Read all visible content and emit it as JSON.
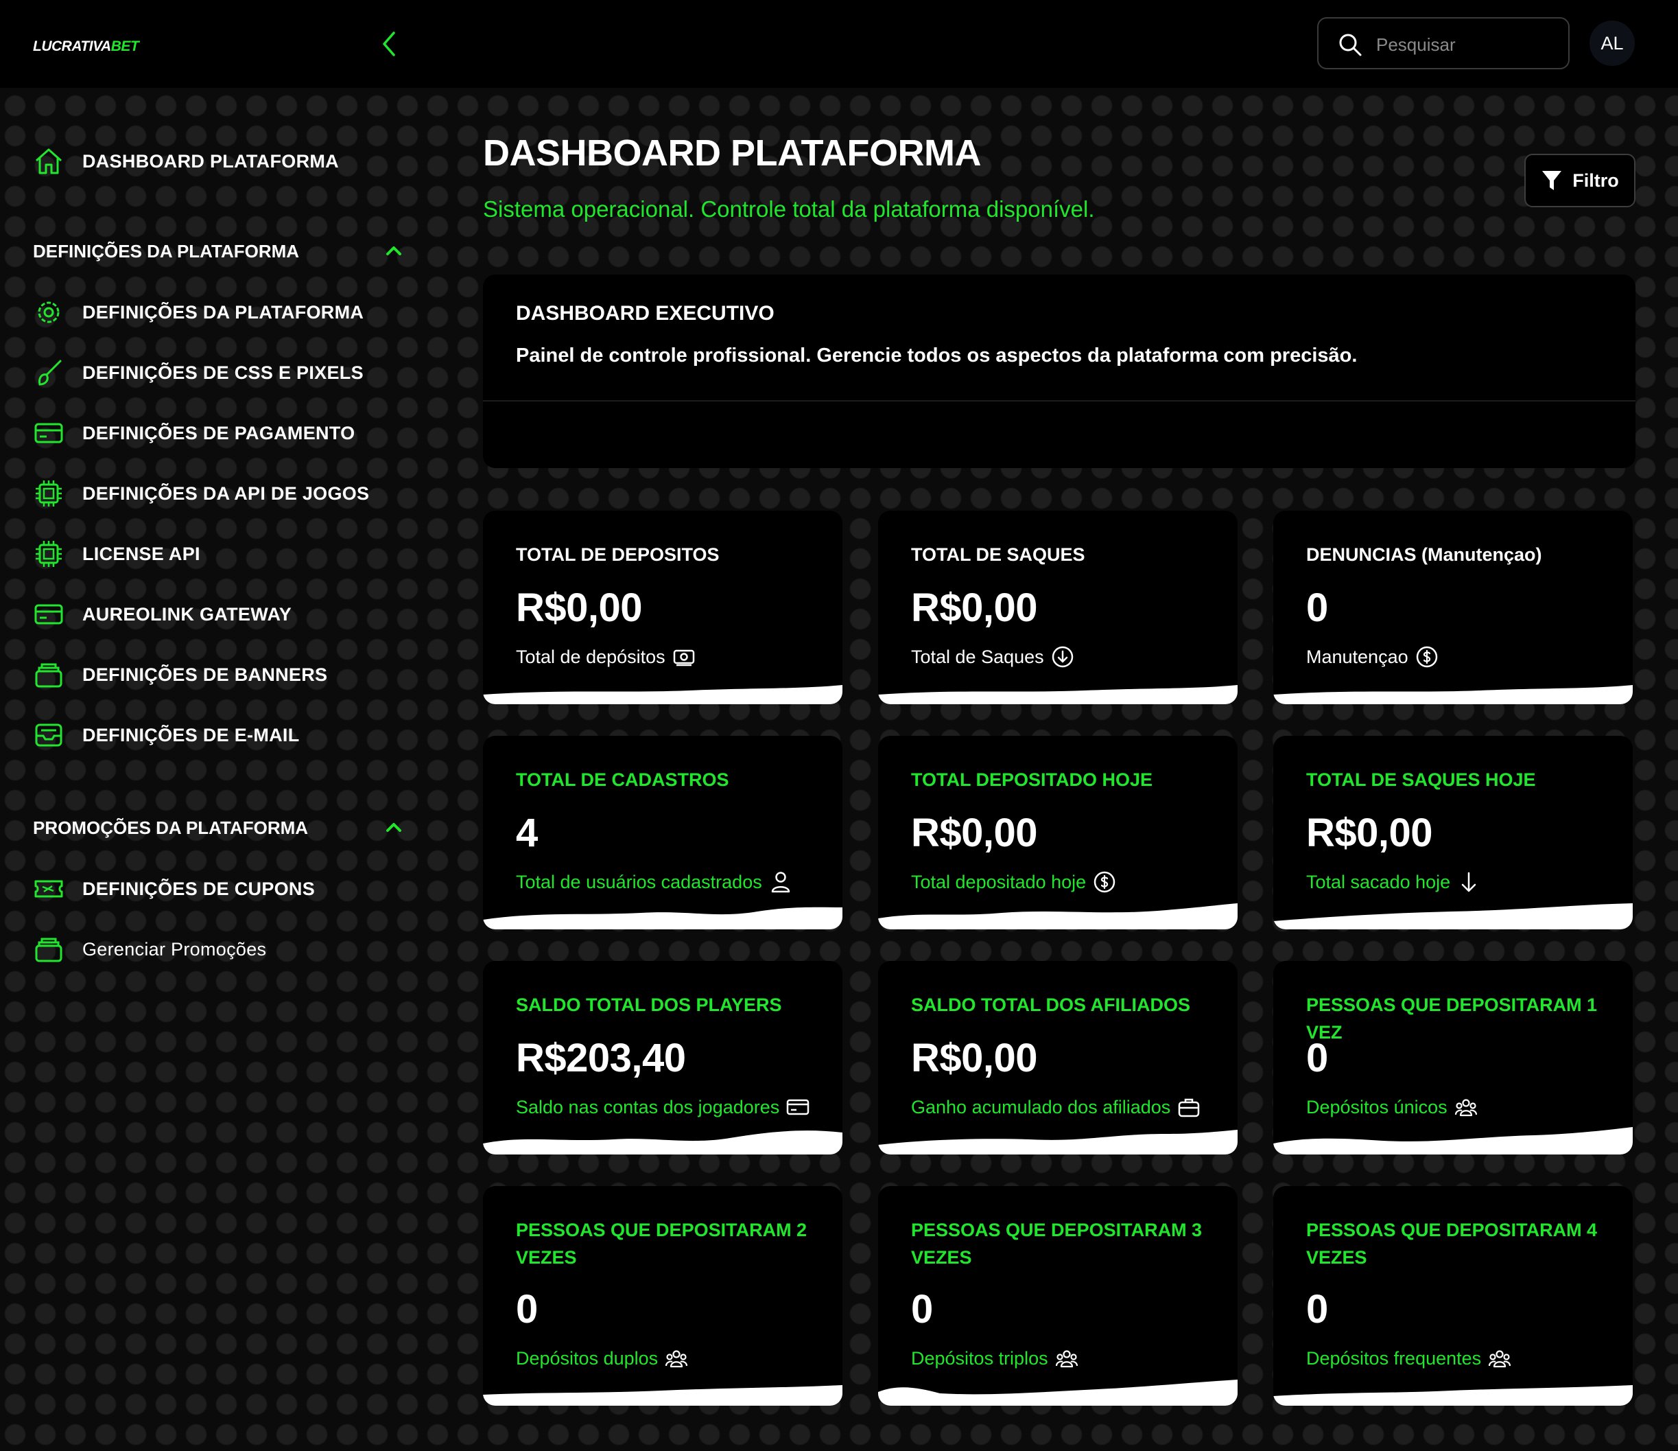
{
  "header": {
    "logo_word": "LUCRATIVA",
    "logo_accent": "BET",
    "search_placeholder": "Pesquisar",
    "avatar_initials": "AL"
  },
  "sidebar": {
    "dashboard": {
      "label": "DASHBOARD PLATAFORMA",
      "icon": "home-icon"
    },
    "section1": {
      "label": "DEFINIÇÕES DA PLATAFORMA",
      "items": [
        {
          "label": "DEFINIÇÕES DA PLATAFORMA",
          "icon": "gear-icon"
        },
        {
          "label": "DEFINIÇÕES DE CSS E PIXELS",
          "icon": "brush-icon"
        },
        {
          "label": "DEFINIÇÕES DE PAGAMENTO",
          "icon": "credit-card-icon"
        },
        {
          "label": "DEFINIÇÕES DA API DE JOGOS",
          "icon": "chip-icon"
        },
        {
          "label": "LICENSE API",
          "icon": "chip-icon"
        },
        {
          "label": "AUREOLINK GATEWAY",
          "icon": "credit-card-icon"
        },
        {
          "label": "DEFINIÇÕES DE BANNERS",
          "icon": "stack-icon"
        },
        {
          "label": "DEFINIÇÕES DE E-MAIL",
          "icon": "inbox-icon"
        }
      ]
    },
    "section2": {
      "label": "PROMOÇÕES DA PLATAFORMA",
      "items": [
        {
          "label": "DEFINIÇÕES DE CUPONS",
          "icon": "ticket-icon"
        },
        {
          "label": "Gerenciar Promoções",
          "icon": "stack-icon"
        }
      ]
    }
  },
  "main": {
    "title": "DASHBOARD PLATAFORMA",
    "subtitle": "Sistema operacional. Controle total da plataforma disponível.",
    "filter_label": "Filtro",
    "exec_title": "DASHBOARD EXECUTIVO",
    "exec_desc": "Painel de controle profissional. Gerencie todos os aspectos da plataforma com precisão."
  },
  "cards": [
    {
      "title": "TOTAL DE DEPOSITOS",
      "value": "R$0,00",
      "desc": "Total de depósitos",
      "icon": "money-icon"
    },
    {
      "title": "TOTAL DE SAQUES",
      "value": "R$0,00",
      "desc": "Total de Saques",
      "icon": "arrow-down-circle-icon"
    },
    {
      "title": "DENUNCIAS (Manutençao)",
      "value": "0",
      "desc": "Manutençao",
      "icon": "dollar-circle-icon"
    },
    {
      "title": "TOTAL DE CADASTROS",
      "value": "4",
      "desc": "Total de usuários cadastrados",
      "icon": "user-icon"
    },
    {
      "title": "TOTAL DEPOSITADO HOJE",
      "value": "R$0,00",
      "desc": "Total depositado hoje",
      "icon": "dollar-circle-icon"
    },
    {
      "title": "TOTAL DE SAQUES HOJE",
      "value": "R$0,00",
      "desc": "Total sacado hoje",
      "icon": "arrow-down-icon"
    },
    {
      "title": "SALDO TOTAL DOS PLAYERS",
      "value": "R$203,40",
      "desc": "Saldo nas contas dos jogadores",
      "icon": "credit-card-icon"
    },
    {
      "title": "SALDO TOTAL DOS AFILIADOS",
      "value": "R$0,00",
      "desc": "Ganho acumulado dos afiliados",
      "icon": "briefcase-icon"
    },
    {
      "title": "PESSOAS QUE DEPOSITARAM 1 VEZ",
      "value": "0",
      "desc": "Depósitos únicos",
      "icon": "group-icon"
    },
    {
      "title": "PESSOAS QUE DEPOSITARAM 2 VEZES",
      "value": "0",
      "desc": "Depósitos duplos",
      "icon": "group-icon"
    },
    {
      "title": "PESSOAS QUE DEPOSITARAM 3 VEZES",
      "value": "0",
      "desc": "Depósitos triplos",
      "icon": "group-icon"
    },
    {
      "title": "PESSOAS QUE DEPOSITARAM 4 VEZES",
      "value": "0",
      "desc": "Depósitos frequentes",
      "icon": "group-icon"
    }
  ],
  "colors": {
    "accent": "#22e62e",
    "background": "#0b0b0b",
    "card": "#000000"
  }
}
